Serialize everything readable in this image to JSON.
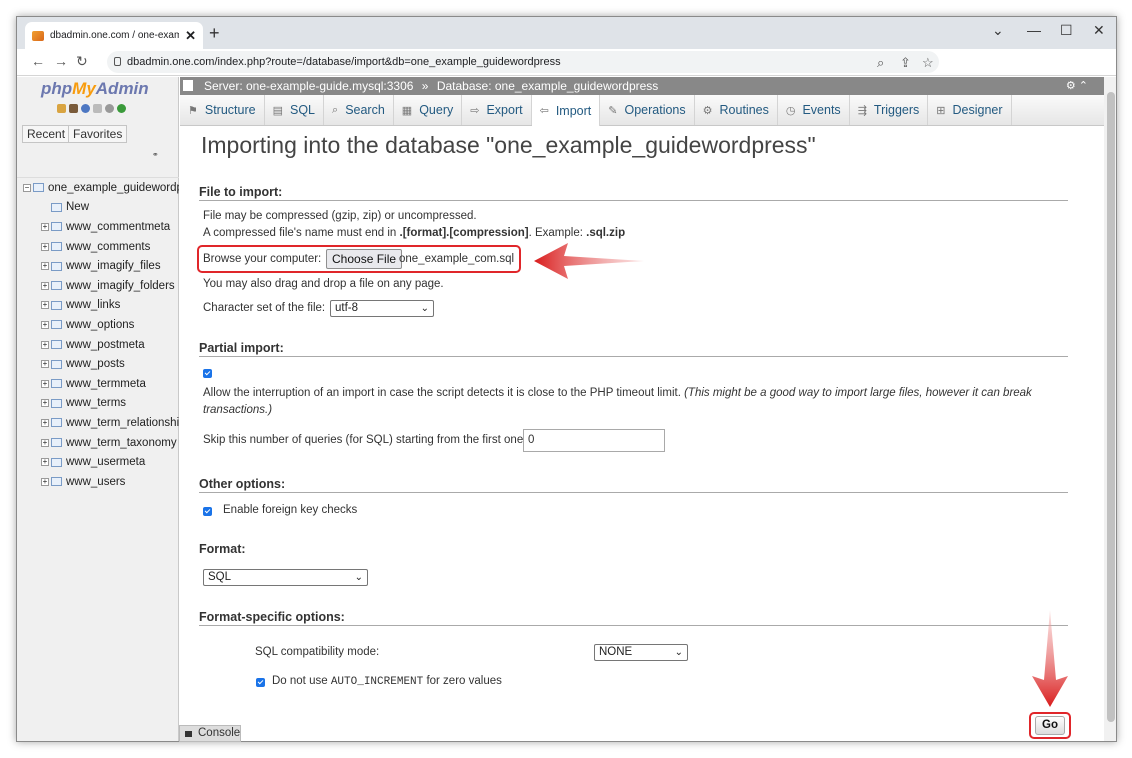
{
  "browser": {
    "tab_title": "dbadmin.one.com / one-example",
    "new_tab": "+",
    "tab_close": "✕",
    "url": "dbadmin.one.com/index.php?route=/database/import&db=one_example_guidewordpress"
  },
  "pma": {
    "logo_php": "php",
    "logo_my": "My",
    "logo_admin": "Admin",
    "recent": "Recent",
    "favorites": "Favorites",
    "tree": [
      "one_example_guidewordpress",
      "New",
      "www_commentmeta",
      "www_comments",
      "www_imagify_files",
      "www_imagify_folders",
      "www_links",
      "www_options",
      "www_postmeta",
      "www_posts",
      "www_termmeta",
      "www_terms",
      "www_term_relationships",
      "www_term_taxonomy",
      "www_usermeta",
      "www_users"
    ]
  },
  "breadcrumb": {
    "server": "Server: one-example-guide.mysql:3306",
    "sep": "»",
    "database": "Database: one_example_guidewordpress"
  },
  "tabs": [
    "Structure",
    "SQL",
    "Search",
    "Query",
    "Export",
    "Import",
    "Operations",
    "Routines",
    "Events",
    "Triggers",
    "Designer"
  ],
  "active_tab": "Import",
  "page": {
    "title": "Importing into the database \"one_example_guidewordpress\"",
    "file_section": "File to import:",
    "compressed_note": "File may be compressed (gzip, zip) or uncompressed.",
    "ext_note_1": "A compressed file's name must end in ",
    "ext_note_bold": ".[format].[compression]",
    "ext_note_2": ". Example: ",
    "ext_note_example": ".sql.zip",
    "browse_label": "Browse your computer:",
    "choose_file": "Choose File",
    "chosen_file": "one_example_com.sql",
    "drag_note": "You may also drag and drop a file on any page.",
    "charset_label": "Character set of the file:",
    "charset_value": "utf-8",
    "partial_section": "Partial import:",
    "interrupt_text": "Allow the interruption of an import in case the script detects it is close to the PHP timeout limit.",
    "interrupt_italic_1": "(This might be a good way to import large files, however it can break",
    "interrupt_italic_2": "transactions.)",
    "skip_label": "Skip this number of queries (for SQL) starting from the first one:",
    "skip_value": "0",
    "other_section": "Other options:",
    "fk_label": "Enable foreign key checks",
    "format_section": "Format:",
    "format_value": "SQL",
    "format_specific_section": "Format-specific options:",
    "compat_label": "SQL compatibility mode:",
    "compat_value": "NONE",
    "auto_inc_1": "Do not use ",
    "auto_inc_code": "AUTO_INCREMENT",
    "auto_inc_2": " for zero values",
    "go": "Go",
    "console": "Console"
  },
  "colors": {
    "accent": "#e0262a",
    "link": "#235a81"
  }
}
